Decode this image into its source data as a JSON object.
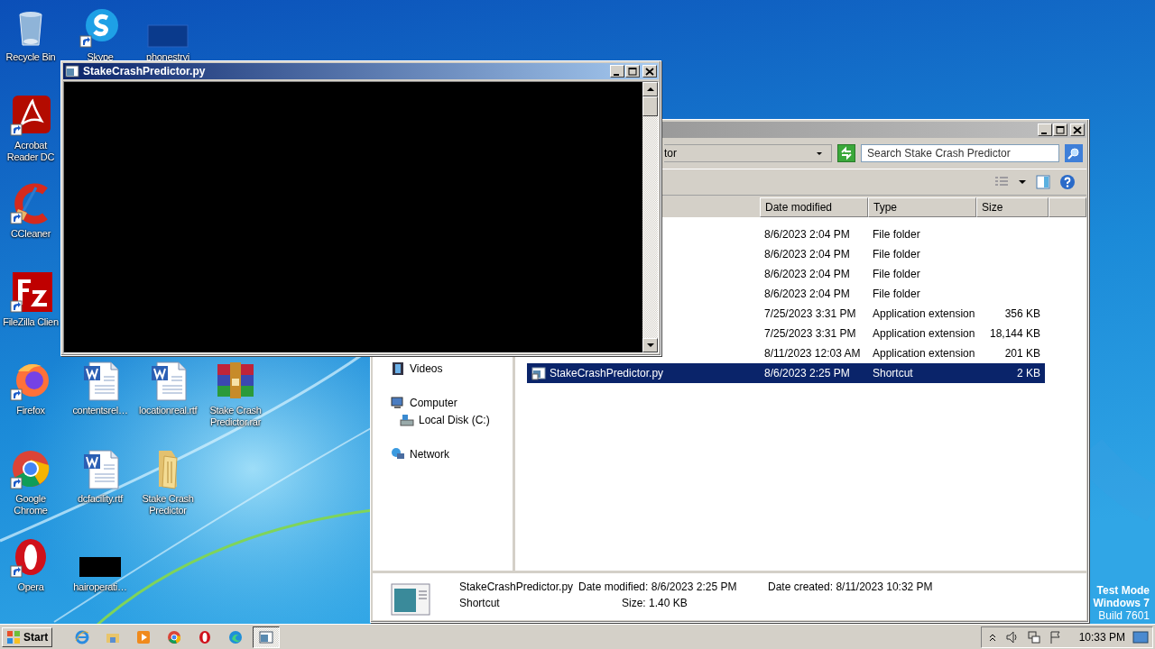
{
  "desktop": {
    "icons": [
      {
        "label": "Recycle Bin",
        "kind": "recycle",
        "shortcut": false
      },
      {
        "label": "Skype",
        "kind": "skype",
        "shortcut": true
      },
      {
        "label": "phonestryi",
        "kind": "blank",
        "shortcut": false
      },
      {
        "label": "Acrobat Reader DC",
        "kind": "acrobat",
        "shortcut": true
      },
      {
        "label": "CCleaner",
        "kind": "ccleaner",
        "shortcut": true
      },
      {
        "label": "FileZilla Clien",
        "kind": "filezilla",
        "shortcut": true
      },
      {
        "label": "Firefox",
        "kind": "firefox",
        "shortcut": true
      },
      {
        "label": "contentsrel…",
        "kind": "document",
        "shortcut": false
      },
      {
        "label": "locationreal.rtf",
        "kind": "document",
        "shortcut": false
      },
      {
        "label": "Stake Crash Predictor.rar",
        "kind": "archive",
        "shortcut": false
      },
      {
        "label": "Google Chrome",
        "kind": "chrome",
        "shortcut": true
      },
      {
        "label": "dcfacility.rtf",
        "kind": "document",
        "shortcut": false
      },
      {
        "label": "Stake Crash Predictor",
        "kind": "folder",
        "shortcut": false
      },
      {
        "label": "Opera",
        "kind": "opera",
        "shortcut": true
      },
      {
        "label": "hairoperati…",
        "kind": "thumbnail",
        "shortcut": false
      }
    ],
    "watermark": [
      "Test Mode",
      "Windows 7",
      "Build 7601"
    ]
  },
  "console": {
    "title": "StakeCrashPredictor.py"
  },
  "explorer": {
    "address": "tor",
    "search": {
      "placeholder": "Search Stake Crash Predictor"
    },
    "columns": [
      "Date modified",
      "Type",
      "Size"
    ],
    "rows": [
      {
        "date": "8/6/2023 2:04 PM",
        "type": "File folder",
        "selected": false
      },
      {
        "date": "8/6/2023 2:04 PM",
        "type": "File folder",
        "selected": false
      },
      {
        "date": "8/6/2023 2:04 PM",
        "type": "File folder",
        "selected": false
      },
      {
        "date": "8/6/2023 2:04 PM",
        "type": "File folder",
        "selected": false
      },
      {
        "date": "7/25/2023 3:31 PM",
        "type": "Application extension",
        "size": "356 KB",
        "selected": false
      },
      {
        "date": "7/25/2023 3:31 PM",
        "type": "Application extension",
        "size": "18,144 KB",
        "selected": false
      },
      {
        "date": "8/11/2023 12:03 AM",
        "type": "Application extension",
        "size": "201 KB",
        "selected": false
      },
      {
        "name": "StakeCrashPredictor.py",
        "date": "8/6/2023 2:25 PM",
        "type": "Shortcut",
        "size": "2 KB",
        "selected": true
      }
    ],
    "nav": [
      {
        "label": "Videos",
        "kind": "videos"
      },
      {
        "label": "Computer",
        "kind": "computer",
        "children": [
          {
            "label": "Local Disk (C:)",
            "kind": "disk"
          }
        ]
      },
      {
        "label": "Network",
        "kind": "network"
      }
    ],
    "details": {
      "name": "StakeCrashPredictor.py",
      "type": "Shortcut",
      "fields": [
        {
          "label": "Date modified:",
          "value": "8/6/2023 2:25 PM"
        },
        {
          "label": "Size:",
          "value": "1.40 KB"
        },
        {
          "label": "Date created:",
          "value": "8/11/2023 10:32 PM"
        }
      ]
    }
  },
  "taskbar": {
    "start": "Start",
    "apps": [
      {
        "kind": "ie",
        "active": false
      },
      {
        "kind": "explorer",
        "active": false
      },
      {
        "kind": "media",
        "active": false
      },
      {
        "kind": "chrome",
        "active": false
      },
      {
        "kind": "opera",
        "active": false
      },
      {
        "kind": "edge",
        "active": false
      },
      {
        "kind": "console",
        "active": true
      }
    ],
    "clock": "10:33 PM"
  }
}
